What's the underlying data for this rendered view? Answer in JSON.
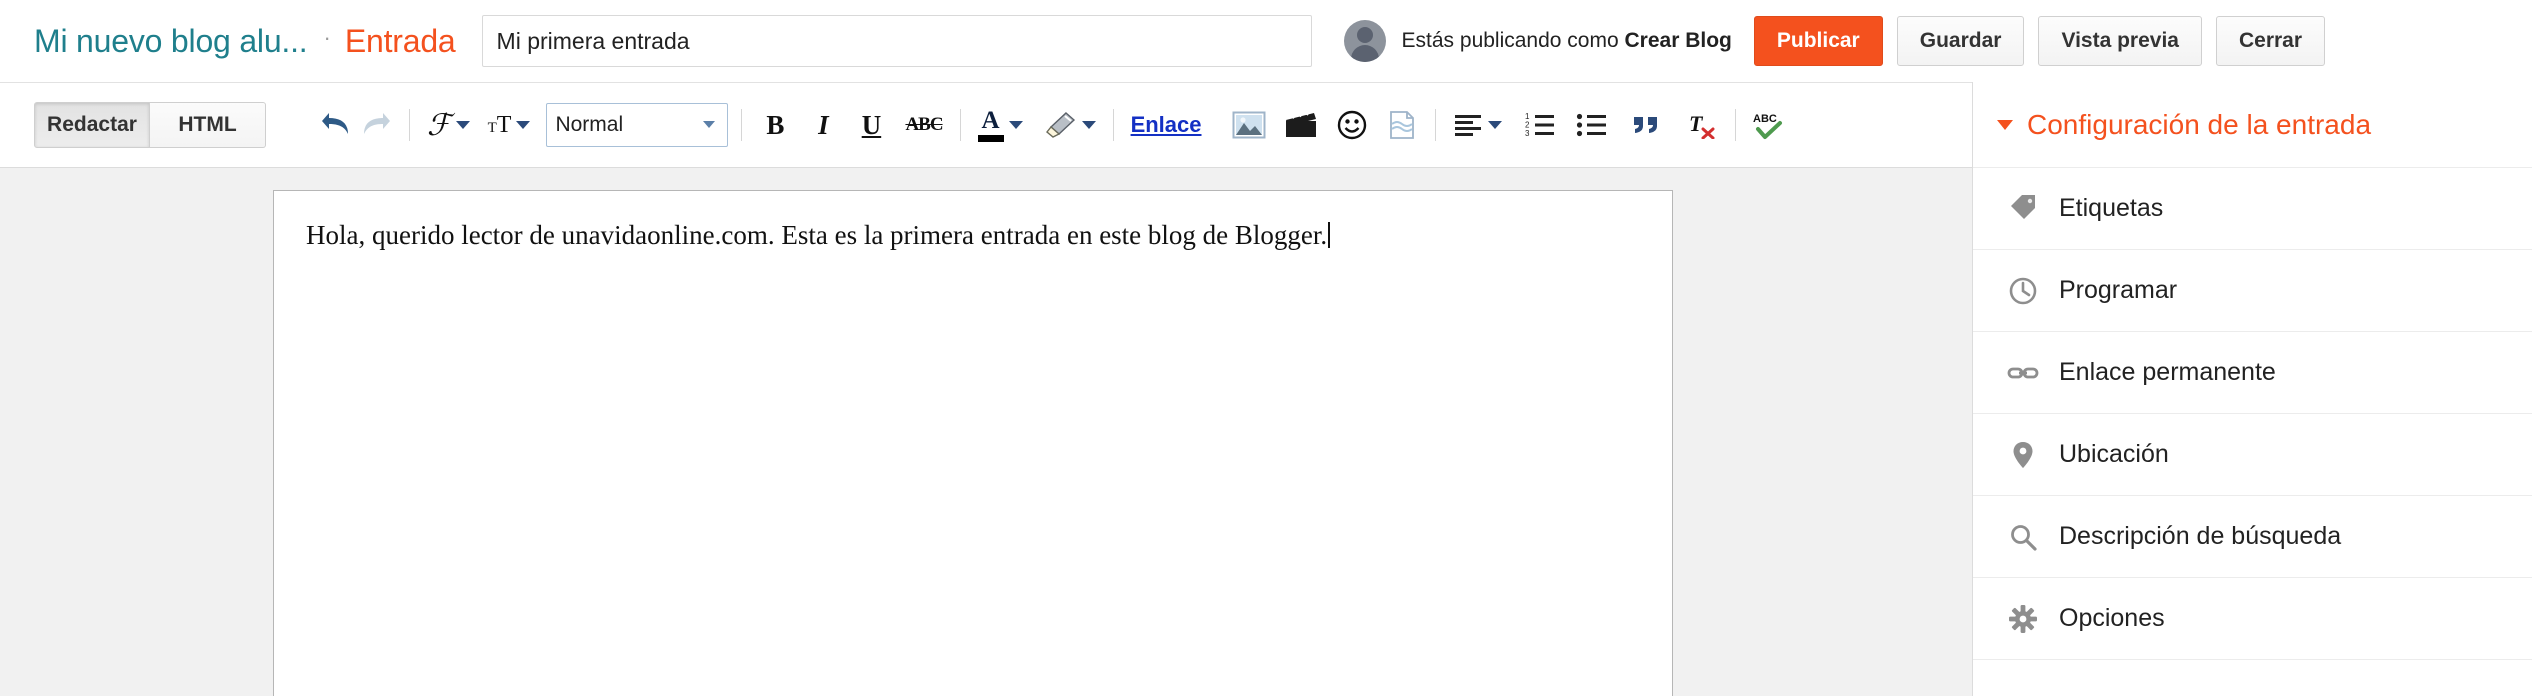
{
  "header": {
    "blog_title": "Mi nuevo blog alu...",
    "separator": "·",
    "entry_label": "Entrada",
    "post_title_value": "Mi primera entrada",
    "post_title_placeholder": "Título de la entrada",
    "publishing_prefix": "Estás publicando como ",
    "publishing_account": "Crear Blog",
    "buttons": {
      "publish": "Publicar",
      "save": "Guardar",
      "preview": "Vista previa",
      "close": "Cerrar"
    }
  },
  "toolbar": {
    "modes": [
      {
        "label": "Redactar",
        "active": true
      },
      {
        "label": "HTML",
        "active": false
      }
    ],
    "undo": "Deshacer",
    "redo": "Rehacer",
    "font_family": "Fuente",
    "font_size": "Tamaño de fuente",
    "format_select_value": "Normal",
    "bold": "B",
    "italic": "I",
    "underline": "U",
    "strikethrough": "ABC",
    "text_color": "A",
    "text_color_swatch": "#000000",
    "highlight": "Color de fondo",
    "link": "Enlace",
    "insert_image": "Insertar imagen",
    "insert_video": "Insertar vídeo",
    "insert_emoji": "Insertar emoticono",
    "jump_break": "Salto de página",
    "alignment": "Alineación",
    "numbered_list": "Lista numerada",
    "bullet_list": "Lista con viñetas",
    "blockquote": "Cita",
    "remove_formatting": "Quitar formato",
    "spellcheck": "Corrector ortográfico"
  },
  "editor": {
    "content": "Hola, querido lector de unavidaonline.com. Esta es la primera entrada en este blog de Blogger."
  },
  "sidebar": {
    "title": "Configuración de la entrada",
    "items": [
      {
        "label": "Etiquetas",
        "icon": "tag-icon"
      },
      {
        "label": "Programar",
        "icon": "clock-icon"
      },
      {
        "label": "Enlace permanente",
        "icon": "link-icon"
      },
      {
        "label": "Ubicación",
        "icon": "location-pin-icon"
      },
      {
        "label": "Descripción de búsqueda",
        "icon": "search-icon"
      },
      {
        "label": "Opciones",
        "icon": "gear-icon"
      }
    ]
  },
  "colors": {
    "brand_orange": "#f4511e",
    "blog_teal": "#1f7f8c",
    "link_blue": "#1430c4",
    "page_bg": "#f1f1f1"
  }
}
